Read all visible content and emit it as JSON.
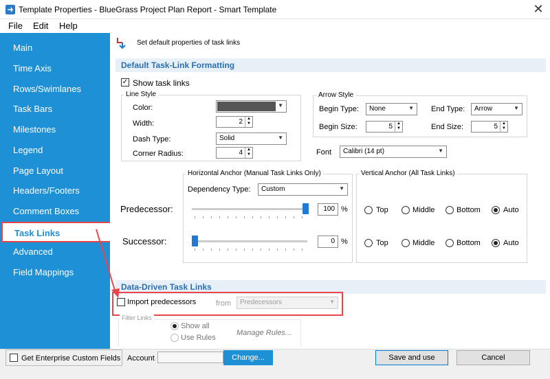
{
  "window": {
    "title": "Template Properties - BlueGrass Project Plan Report - Smart Template",
    "close": "✕"
  },
  "menu": {
    "file": "File",
    "edit": "Edit",
    "help": "Help"
  },
  "sidebar": {
    "items": [
      "Main",
      "Time Axis",
      "Rows/Swimlanes",
      "Task Bars",
      "Milestones",
      "Legend",
      "Page Layout",
      "Headers/Footers",
      "Comment Boxes",
      "Task Links",
      "Advanced",
      "Field Mappings"
    ],
    "active_index": 9
  },
  "header": {
    "description": "Set default properties of task links"
  },
  "formatting": {
    "section_title": "Default Task-Link Formatting",
    "show_links_label": "Show task links",
    "show_links_checked": "✓",
    "line_style": {
      "group_title": "Line Style",
      "color_label": "Color:",
      "width_label": "Width:",
      "width_value": "2",
      "dash_label": "Dash Type:",
      "dash_value": "Solid",
      "radius_label": "Corner Radius:",
      "radius_value": "4"
    },
    "arrow_style": {
      "group_title": "Arrow Style",
      "begin_type_label": "Begin Type:",
      "begin_type_value": "None",
      "end_type_label": "End Type:",
      "end_type_value": "Arrow",
      "begin_size_label": "Begin Size:",
      "begin_size_value": "5",
      "end_size_label": "End Size:",
      "end_size_value": "5"
    },
    "font_label": "Font",
    "font_value": "Calibri (14 pt)",
    "horizontal_anchor": {
      "group_title": "Horizontal Anchor (Manual Task Links Only)",
      "dependency_label": "Dependency Type:",
      "dependency_value": "Custom",
      "predecessor_value": "100",
      "successor_value": "0",
      "percent": "%"
    },
    "vertical_anchor": {
      "group_title": "Vertical Anchor (All Task Links)",
      "options": [
        "Top",
        "Middle",
        "Bottom",
        "Auto"
      ],
      "predecessor_selected": "Auto",
      "successor_selected": "Auto"
    },
    "predecessor_label": "Predecessor:",
    "successor_label": "Successor:"
  },
  "data_driven": {
    "section_title": "Data-Driven Task Links",
    "import_label": "Import predecessors",
    "from_label": "from",
    "from_value": "Predecessors",
    "filter_links_label": "Filter Links",
    "show_all_label": "Show all",
    "use_rules_label": "Use Rules",
    "manage_rules_label": "Manage Rules..."
  },
  "bottom": {
    "enterprise_label": "Get Enterprise Custom Fields",
    "account_label": "Account",
    "change_button": "Change...",
    "save_button": "Save and use",
    "cancel_button": "Cancel"
  },
  "colors": {
    "sidebar": "#1e90d6",
    "accent": "#2a6fb1",
    "highlight": "#e8464a",
    "line_color": "#555555"
  }
}
